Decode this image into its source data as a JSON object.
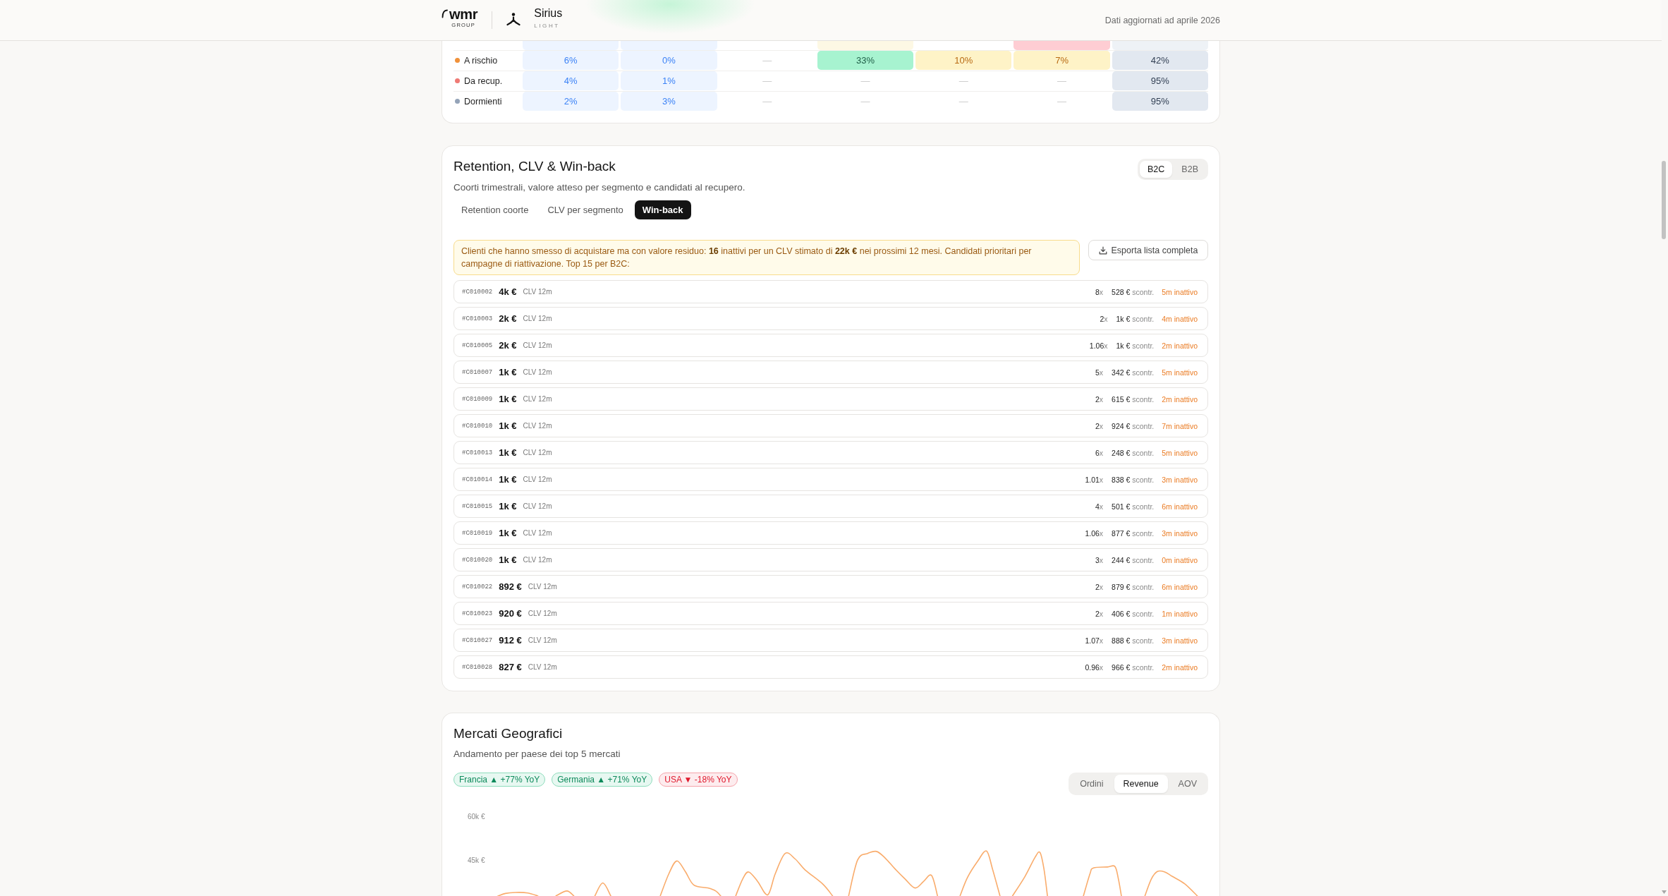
{
  "header": {
    "logo": {
      "wordmark": "wmr",
      "tagline": "GROUP"
    },
    "product": {
      "name": "Sirius",
      "edition": "LIGHT"
    },
    "updated": "Dati aggiornati ad aprile 2026"
  },
  "segment_table": {
    "rows": [
      {
        "clipped": true,
        "cells": [
          {
            "kind": "blue"
          },
          {
            "kind": "blue"
          },
          {
            "kind": "none"
          },
          {
            "kind": "amber-light"
          },
          {
            "kind": "none"
          },
          {
            "kind": "red"
          },
          {
            "kind": "gray-light"
          }
        ]
      },
      {
        "clipped": false,
        "label": "A rischio",
        "color": "#f0913a",
        "cells": [
          {
            "text": "6%",
            "kind": "blue"
          },
          {
            "text": "0%",
            "kind": "blue"
          },
          {
            "text": "—",
            "kind": "none"
          },
          {
            "text": "33%",
            "kind": "green"
          },
          {
            "text": "10%",
            "kind": "amber"
          },
          {
            "text": "7%",
            "kind": "amber"
          },
          {
            "text": "42%",
            "kind": "gray"
          }
        ]
      },
      {
        "clipped": false,
        "label": "Da recup.",
        "color": "#ef7a75",
        "cells": [
          {
            "text": "4%",
            "kind": "blue"
          },
          {
            "text": "1%",
            "kind": "blue"
          },
          {
            "text": "—",
            "kind": "none"
          },
          {
            "text": "—",
            "kind": "none"
          },
          {
            "text": "—",
            "kind": "none"
          },
          {
            "text": "—",
            "kind": "none"
          },
          {
            "text": "95%",
            "kind": "gray"
          }
        ]
      },
      {
        "clipped": false,
        "label": "Dormienti",
        "color": "#94a3b8",
        "cells": [
          {
            "text": "2%",
            "kind": "blue"
          },
          {
            "text": "3%",
            "kind": "blue"
          },
          {
            "text": "—",
            "kind": "none"
          },
          {
            "text": "—",
            "kind": "none"
          },
          {
            "text": "—",
            "kind": "none"
          },
          {
            "text": "—",
            "kind": "none"
          },
          {
            "text": "95%",
            "kind": "gray"
          }
        ]
      }
    ]
  },
  "retention": {
    "title": "Retention, CLV & Win-back",
    "subtitle": "Coorti trimestrali, valore atteso per segmento e candidati al recupero.",
    "channels": [
      {
        "label": "B2C",
        "selected": true
      },
      {
        "label": "B2B",
        "selected": false
      }
    ],
    "tabs": [
      {
        "label": "Retention coorte",
        "selected": false
      },
      {
        "label": "CLV per segmento",
        "selected": false
      },
      {
        "label": "Win-back",
        "selected": true
      }
    ],
    "alert": "Clienti che hanno smesso di acquistare ma con valore residuo: **16** inattivi per un CLV stimato di **22k €** nei prossimi 12 mesi. Candidati prioritari per campagne di riattivazione. Top 15 per B2C:",
    "export_button": "Esporta lista completa",
    "customers": [
      {
        "id": "#C010002",
        "clv": "4k €",
        "clv_label": "CLV 12m",
        "freq": "8",
        "freq_unit": "x",
        "ticket": "528 €",
        "ticket_label": "scontr.",
        "inactive": "5m inattivo"
      },
      {
        "id": "#C010003",
        "clv": "2k €",
        "clv_label": "CLV 12m",
        "freq": "2",
        "freq_unit": "x",
        "ticket": "1k €",
        "ticket_label": "scontr.",
        "inactive": "4m inattivo"
      },
      {
        "id": "#C010005",
        "clv": "2k €",
        "clv_label": "CLV 12m",
        "freq": "1.06",
        "freq_unit": "x",
        "ticket": "1k €",
        "ticket_label": "scontr.",
        "inactive": "2m inattivo"
      },
      {
        "id": "#C010007",
        "clv": "1k €",
        "clv_label": "CLV 12m",
        "freq": "5",
        "freq_unit": "x",
        "ticket": "342 €",
        "ticket_label": "scontr.",
        "inactive": "5m inattivo"
      },
      {
        "id": "#C010009",
        "clv": "1k €",
        "clv_label": "CLV 12m",
        "freq": "2",
        "freq_unit": "x",
        "ticket": "615 €",
        "ticket_label": "scontr.",
        "inactive": "2m inattivo"
      },
      {
        "id": "#C010010",
        "clv": "1k €",
        "clv_label": "CLV 12m",
        "freq": "2",
        "freq_unit": "x",
        "ticket": "924 €",
        "ticket_label": "scontr.",
        "inactive": "7m inattivo"
      },
      {
        "id": "#C010013",
        "clv": "1k €",
        "clv_label": "CLV 12m",
        "freq": "6",
        "freq_unit": "x",
        "ticket": "248 €",
        "ticket_label": "scontr.",
        "inactive": "5m inattivo"
      },
      {
        "id": "#C010014",
        "clv": "1k €",
        "clv_label": "CLV 12m",
        "freq": "1.01",
        "freq_unit": "x",
        "ticket": "838 €",
        "ticket_label": "scontr.",
        "inactive": "3m inattivo"
      },
      {
        "id": "#C010015",
        "clv": "1k €",
        "clv_label": "CLV 12m",
        "freq": "4",
        "freq_unit": "x",
        "ticket": "501 €",
        "ticket_label": "scontr.",
        "inactive": "6m inattivo"
      },
      {
        "id": "#C010019",
        "clv": "1k €",
        "clv_label": "CLV 12m",
        "freq": "1.06",
        "freq_unit": "x",
        "ticket": "877 €",
        "ticket_label": "scontr.",
        "inactive": "3m inattivo"
      },
      {
        "id": "#C010020",
        "clv": "1k €",
        "clv_label": "CLV 12m",
        "freq": "3",
        "freq_unit": "x",
        "ticket": "244 €",
        "ticket_label": "scontr.",
        "inactive": "0m inattivo"
      },
      {
        "id": "#C010022",
        "clv": "892 €",
        "clv_label": "CLV 12m",
        "freq": "2",
        "freq_unit": "x",
        "ticket": "879 €",
        "ticket_label": "scontr.",
        "inactive": "6m inattivo"
      },
      {
        "id": "#C010023",
        "clv": "920 €",
        "clv_label": "CLV 12m",
        "freq": "2",
        "freq_unit": "x",
        "ticket": "406 €",
        "ticket_label": "scontr.",
        "inactive": "1m inattivo"
      },
      {
        "id": "#C010027",
        "clv": "912 €",
        "clv_label": "CLV 12m",
        "freq": "1.07",
        "freq_unit": "x",
        "ticket": "888 €",
        "ticket_label": "scontr.",
        "inactive": "3m inattivo"
      },
      {
        "id": "#C010028",
        "clv": "827 €",
        "clv_label": "CLV 12m",
        "freq": "0.96",
        "freq_unit": "x",
        "ticket": "966 €",
        "ticket_label": "scontr.",
        "inactive": "2m inattivo"
      }
    ]
  },
  "markets": {
    "title": "Mercati Geografici",
    "subtitle": "Andamento per paese dei top 5 mercati",
    "badges": [
      {
        "label": "Francia ▲ +77% YoY",
        "kind": "up"
      },
      {
        "label": "Germania ▲ +71% YoY",
        "kind": "up"
      },
      {
        "label": "USA ▼ -18% YoY",
        "kind": "down"
      }
    ],
    "metrics": [
      {
        "label": "Ordini",
        "selected": false
      },
      {
        "label": "Revenue",
        "selected": true
      },
      {
        "label": "AOV",
        "selected": false
      }
    ],
    "trend_chart": {
      "axis_labels": [
        "60k €",
        "45k €"
      ]
    }
  }
}
